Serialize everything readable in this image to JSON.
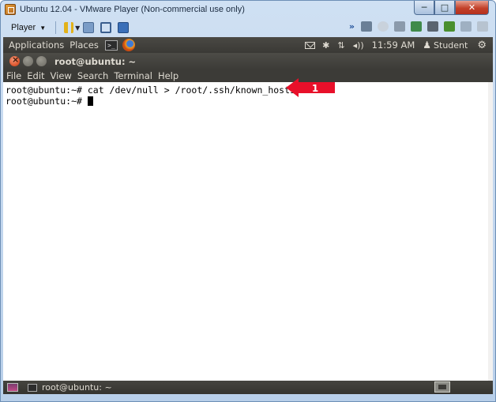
{
  "vmware": {
    "title": "Ubuntu 12.04 - VMware Player (Non-commercial use only)",
    "min_label": "─",
    "max_label": "□",
    "close_label": "✕",
    "player_menu": "Player",
    "chevron": "»"
  },
  "ubuntu_panel": {
    "menus": [
      "Applications",
      "Places"
    ],
    "clock": "11:59 AM",
    "user": "Student",
    "tray_symbols": {
      "bluetooth": "✱",
      "network": "⇅",
      "volume": "◂))",
      "gear": "⚙",
      "user": "♟"
    }
  },
  "terminal": {
    "title": "root@ubuntu: ~",
    "menus": [
      "File",
      "Edit",
      "View",
      "Search",
      "Terminal",
      "Help"
    ],
    "lines": [
      "root@ubuntu:~# cat /dev/null > /root/.ssh/known_hosts",
      "root@ubuntu:~# "
    ]
  },
  "callout": {
    "number": "1",
    "color": "#e8102a"
  },
  "taskbar": {
    "window_label": "root@ubuntu: ~"
  }
}
